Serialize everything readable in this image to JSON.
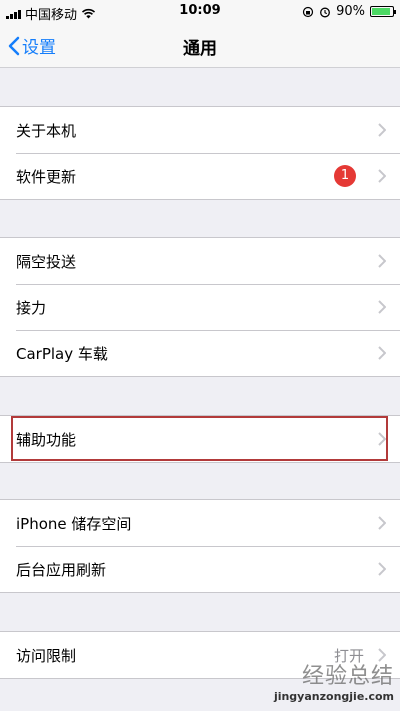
{
  "status_bar": {
    "carrier": "中国移动",
    "time": "10:09",
    "battery_percent": "90%",
    "battery_level": 0.9
  },
  "nav": {
    "back_label": "设置",
    "title": "通用"
  },
  "groups": [
    {
      "items": [
        {
          "label": "关于本机"
        },
        {
          "label": "软件更新",
          "badge": "1"
        }
      ]
    },
    {
      "items": [
        {
          "label": "隔空投送"
        },
        {
          "label": "接力"
        },
        {
          "label": "CarPlay 车载"
        }
      ]
    },
    {
      "items": [
        {
          "label": "辅助功能"
        }
      ]
    },
    {
      "items": [
        {
          "label": "iPhone 储存空间"
        },
        {
          "label": "后台应用刷新"
        }
      ]
    },
    {
      "items": [
        {
          "label": "访问限制",
          "value": "打开"
        }
      ]
    }
  ],
  "watermark": {
    "text": "经验总结",
    "url": "jingyanzongjie.com"
  },
  "colors": {
    "accent": "#157efb",
    "badge": "#e53935",
    "highlight": "#b23a3a",
    "background": "#efeff4"
  }
}
